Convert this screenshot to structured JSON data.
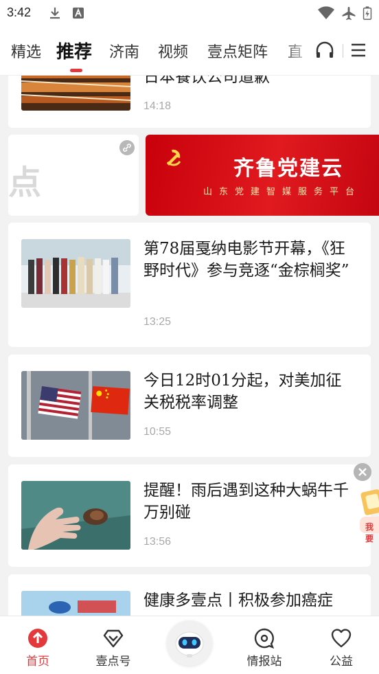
{
  "status_bar": {
    "time": "3:42"
  },
  "channels": [
    "精选",
    "推荐",
    "济南",
    "视频",
    "壹点矩阵",
    "直"
  ],
  "active_channel": "推荐",
  "feed": {
    "top_card": {
      "headline": "日本餐饮公司道歉",
      "time": "14:18"
    },
    "banner": {
      "left_text": "点",
      "title": "齐鲁党建云",
      "subtitle": "山东党建智媒服务平台"
    },
    "articles": [
      {
        "headline": "第78届戛纳电影节开幕，《狂野时代》参与竞逐“金棕榈奖”",
        "time": "13:25"
      },
      {
        "headline": "今日12时01分起，对美加征关税税率调整",
        "time": "10:55"
      },
      {
        "headline": "提醒！雨后遇到这种大蜗牛千万别碰",
        "time": "13:56"
      },
      {
        "headline": "健康多壹点丨积极参加癌症",
        "time": ""
      }
    ],
    "floating_badge": "我要"
  },
  "bottom_nav": [
    {
      "label": "首页",
      "icon": "home-upload-icon"
    },
    {
      "label": "壹点号",
      "icon": "heart-shield-icon"
    },
    {
      "label": "",
      "icon": "robot-assistant-icon"
    },
    {
      "label": "情报站",
      "icon": "chat-bubble-icon"
    },
    {
      "label": "公益",
      "icon": "heart-icon"
    }
  ],
  "colors": {
    "accent": "#e4393c",
    "banner_red": "#d0000f"
  }
}
